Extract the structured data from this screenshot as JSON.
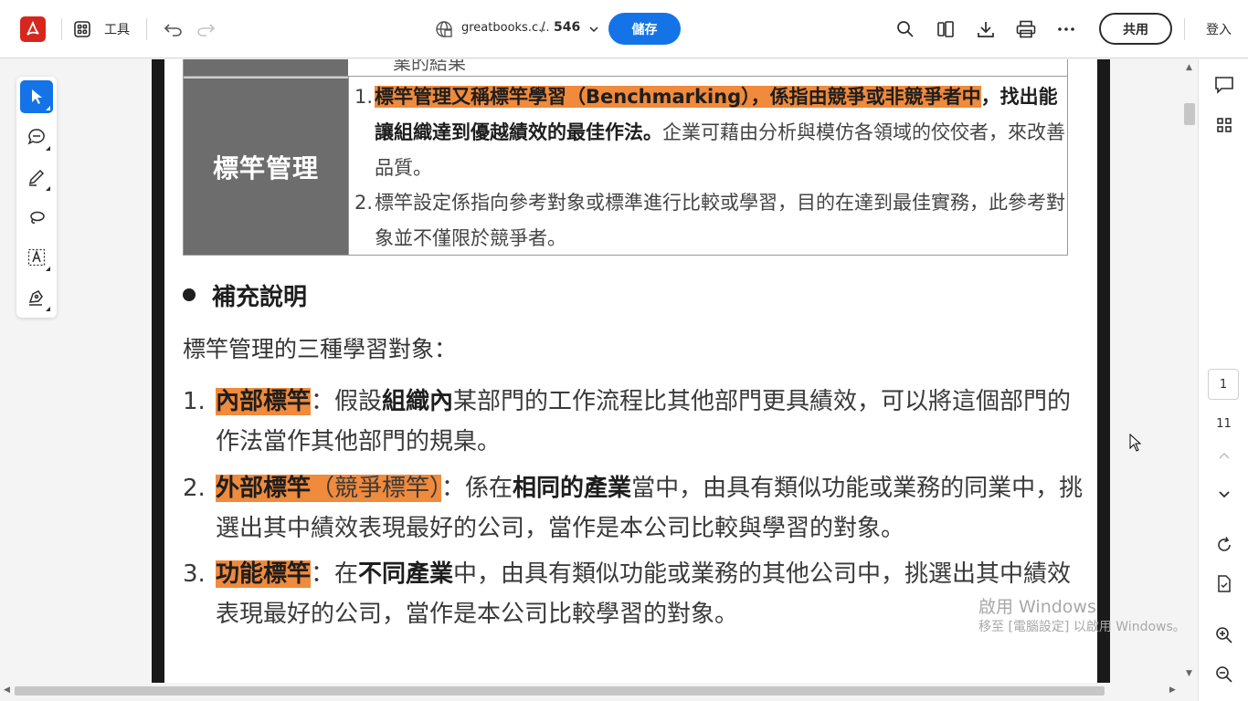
{
  "toolbar": {
    "tools_label": "工具",
    "file_name": "greatbooks.c...",
    "separator": "/",
    "page_count": "546",
    "save_label": "儲存",
    "share_label": "共用",
    "login_label": "登入"
  },
  "palette": {
    "tools": [
      "select-tool",
      "comment-tool",
      "draw-tool",
      "lasso-tool",
      "text-recognition-tool",
      "sign-tool"
    ]
  },
  "document": {
    "prev_row_text": "業的結果",
    "table": {
      "term": "標竿管理",
      "items": [
        {
          "num": "1.",
          "highlight": "標竿管理又稱標竿學習（Benchmarking），係指由競爭或非競爭者中",
          "bold": "，找出能讓組織達到優越績效的最佳作法。",
          "normal": "企業可藉由分析與模仿各領域的佼佼者，來改善品質。"
        },
        {
          "num": "2.",
          "text": "標竿設定係指向參考對象或標準進行比較或學習，目的在達到最佳實務，此參考對象並不僅限於競爭者。"
        }
      ]
    },
    "supplement_title": "補充說明",
    "intro": "標竿管理的三種學習對象：",
    "list": [
      {
        "num": "1.",
        "label": "內部標竿",
        "t1": "：假設",
        "bold": "組織內",
        "t2": "某部門的工作流程比其他部門更具績效，可以將這個部門的作法當作其他部門的規臬。"
      },
      {
        "num": "2.",
        "label": "外部標竿",
        "label_sub": "（競爭標竿）",
        "t1": "：係在",
        "bold": "相同的產業",
        "t2": "當中，由具有類似功能或業務的同業中，挑選出其中績效表現最好的公司，當作是本公司比較與學習的對象。"
      },
      {
        "num": "3.",
        "label": "功能標竿",
        "t1": "：在",
        "bold": "不同產業",
        "t2": "中，由具有類似功能或業務的其他公司中，挑選出其中績效表現最好的公司，當作是本公司比較學習的對象。"
      }
    ]
  },
  "navigator": {
    "current_page": "1",
    "total_pages": "11"
  },
  "watermark": {
    "line1": "啟用 Windows",
    "line2": "移至 [電腦設定] 以啟用 Windows。"
  },
  "colors": {
    "accent": "#1473e6",
    "highlight": "#f08a3c",
    "acrobat_red": "#d7261e",
    "table_header": "#6d6d6e"
  }
}
